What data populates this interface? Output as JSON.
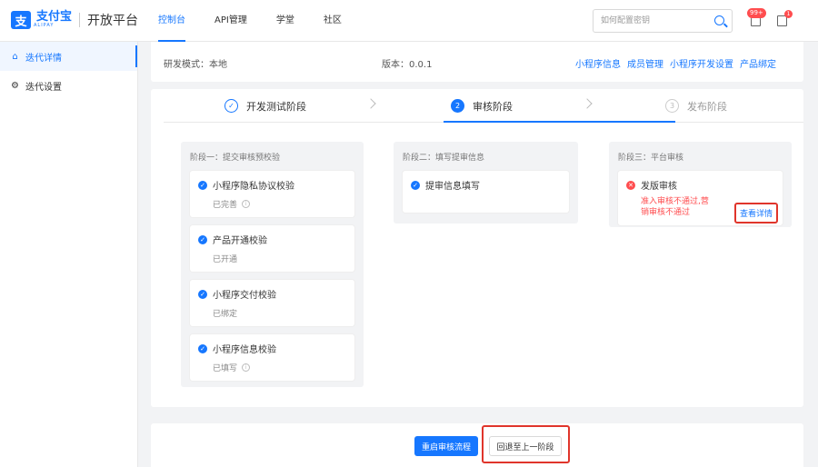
{
  "brand": {
    "logo_char": "支",
    "name_cn": "支付宝",
    "name_en": "ALIPAY",
    "platform": "开放平台"
  },
  "nav": {
    "items": [
      "控制台",
      "API管理",
      "学堂",
      "社区"
    ]
  },
  "search": {
    "placeholder": "如何配置密钥"
  },
  "notifications": {
    "bell_badge": "99+",
    "message_badge": "1"
  },
  "sidebar": {
    "items": [
      {
        "label": "迭代详情",
        "icon": "home-icon",
        "active": true
      },
      {
        "label": "迭代设置",
        "icon": "gear-icon",
        "active": false
      }
    ]
  },
  "info": {
    "mode": "研发模式：本地",
    "version": "版本：0.0.1",
    "links": [
      "小程序信息",
      "成员管理",
      "小程序开发设置",
      "产品绑定"
    ]
  },
  "steps": [
    {
      "num": "✓",
      "label": "开发测试阶段",
      "state": "done"
    },
    {
      "num": "2",
      "label": "审核阶段",
      "state": "active"
    },
    {
      "num": "3",
      "label": "发布阶段",
      "state": "wait"
    }
  ],
  "stage1": {
    "title": "阶段一：提交审核预校验",
    "items": [
      {
        "label": "小程序隐私协议校验",
        "status": "已完善"
      },
      {
        "label": "产品开通校验",
        "status": "已开通"
      },
      {
        "label": "小程序交付校验",
        "status": "已绑定"
      },
      {
        "label": "小程序信息校验",
        "status": "已填写"
      }
    ]
  },
  "stage2": {
    "title": "阶段二：填写提审信息",
    "items": [
      {
        "label": "提审信息填写"
      }
    ]
  },
  "stage3": {
    "title": "阶段三：平台审核",
    "item_label": "发版审核",
    "error": "准入审核不通过,营销审核不通过",
    "detail_link": "查看详情"
  },
  "actions": {
    "restart": "重启审核流程",
    "rollback": "回退至上一阶段"
  },
  "colors": {
    "accent": "#1677ff",
    "error": "#ff4d4f",
    "highlight": "#e0352b"
  }
}
